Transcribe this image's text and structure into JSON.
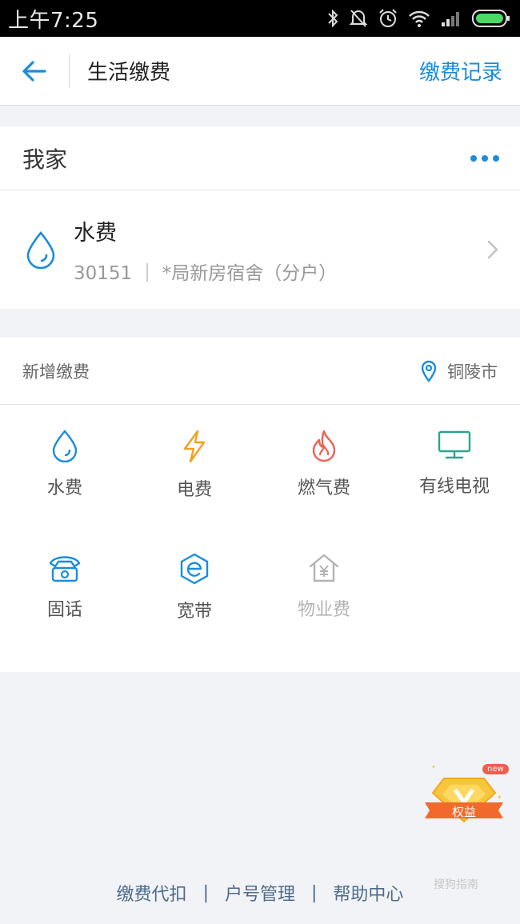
{
  "status_bar": {
    "time": "上午7:25"
  },
  "header": {
    "title": "生活缴费",
    "record_link": "缴费记录"
  },
  "group": {
    "name": "我家"
  },
  "bill": {
    "name": "水费",
    "account": "30151 ｜ *局新房宿舍（分户）"
  },
  "add_section": {
    "title": "新增缴费",
    "city": "铜陵市"
  },
  "services": [
    {
      "label": "水费",
      "icon": "water-drop-icon"
    },
    {
      "label": "电费",
      "icon": "lightning-icon"
    },
    {
      "label": "燃气费",
      "icon": "flame-icon"
    },
    {
      "label": "有线电视",
      "icon": "tv-icon"
    },
    {
      "label": "固话",
      "icon": "telephone-icon"
    },
    {
      "label": "宽带",
      "icon": "broadband-icon"
    },
    {
      "label": "物业费",
      "icon": "property-icon"
    }
  ],
  "badge": {
    "text": "权益",
    "new_label": "new"
  },
  "footer": {
    "links": [
      "缴费代扣",
      "户号管理",
      "帮助中心"
    ]
  },
  "watermark": "搜狗指南",
  "colors": {
    "accent": "#1a8cde",
    "electric": "#f0a020",
    "gas": "#f06050",
    "tv": "#2aa58e"
  }
}
